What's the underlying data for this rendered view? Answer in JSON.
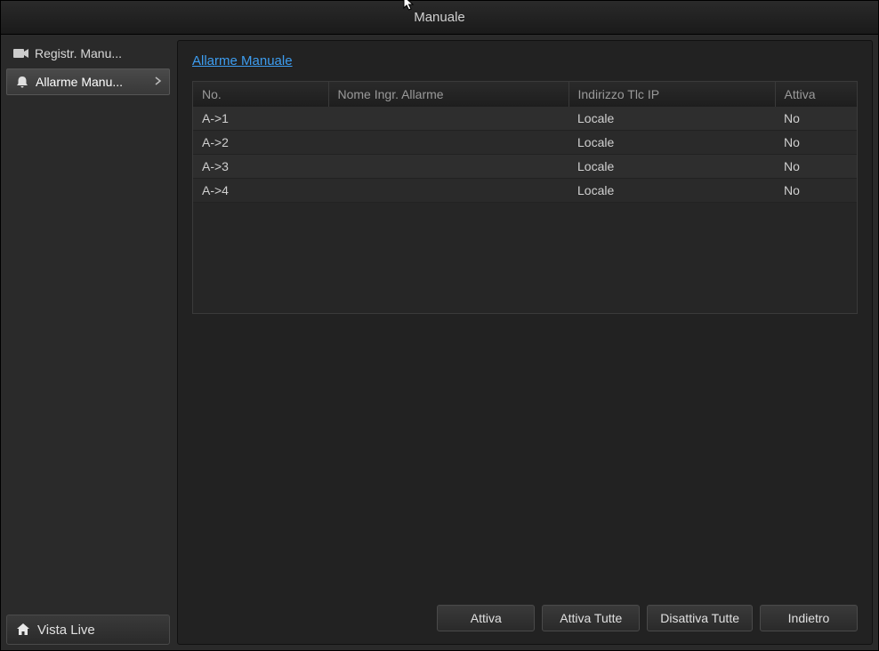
{
  "window": {
    "title": "Manuale"
  },
  "sidebar": {
    "items": [
      {
        "label": "Registr. Manu...",
        "active": false
      },
      {
        "label": "Allarme Manu...",
        "active": true
      }
    ],
    "bottom": {
      "label": "Vista Live"
    }
  },
  "main": {
    "title": "Allarme Manuale",
    "columns": {
      "no": "No.",
      "name": "Nome Ingr. Allarme",
      "ip": "Indirizzo Tlc IP",
      "attiva": "Attiva"
    },
    "rows": [
      {
        "no": "A->1",
        "name": "",
        "ip": "Locale",
        "attiva": "No"
      },
      {
        "no": "A->2",
        "name": "",
        "ip": "Locale",
        "attiva": "No"
      },
      {
        "no": "A->3",
        "name": "",
        "ip": "Locale",
        "attiva": "No"
      },
      {
        "no": "A->4",
        "name": "",
        "ip": "Locale",
        "attiva": "No"
      }
    ]
  },
  "buttons": {
    "attiva": "Attiva",
    "attiva_tutte": "Attiva Tutte",
    "disattiva_tutte": "Disattiva Tutte",
    "indietro": "Indietro"
  }
}
